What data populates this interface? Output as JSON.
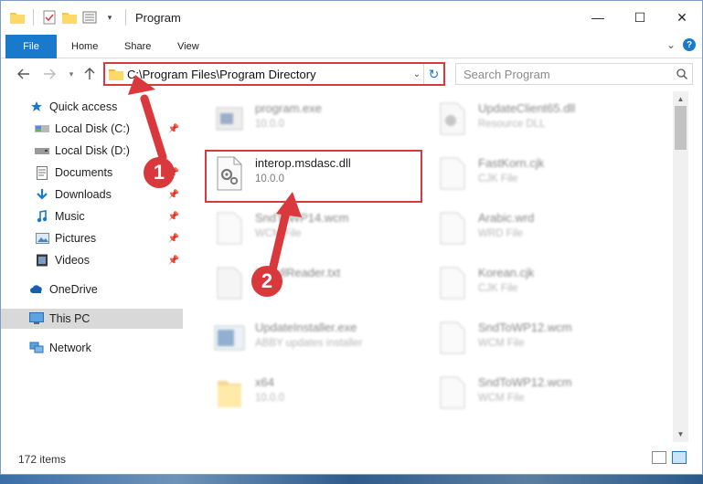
{
  "window": {
    "title": "Program",
    "minimize": "—",
    "maximize": "☐",
    "close": "✕"
  },
  "ribbon": {
    "tabs": [
      "File",
      "Home",
      "Share",
      "View"
    ],
    "help": "?",
    "expand": "⌄"
  },
  "address": {
    "path": "C:\\Program Files\\Program Directory",
    "search_placeholder": "Search Program"
  },
  "sidebar": {
    "items": [
      {
        "label": "Quick access",
        "icon": "star-icon"
      },
      {
        "label": "Local Disk (C:)",
        "icon": "drive-icon",
        "pinned": "📌"
      },
      {
        "label": "Local Disk (D:)",
        "icon": "drive-icon"
      },
      {
        "label": "Documents",
        "icon": "documents-icon",
        "pinned": "📌"
      },
      {
        "label": "Downloads",
        "icon": "download-icon",
        "pinned": "📌"
      },
      {
        "label": "Music",
        "icon": "music-icon",
        "pinned": "📌"
      },
      {
        "label": "Pictures",
        "icon": "pictures-icon",
        "pinned": "📌"
      },
      {
        "label": "Videos",
        "icon": "videos-icon",
        "pinned": "📌"
      },
      {
        "label": "OneDrive",
        "icon": "cloud-icon"
      },
      {
        "label": "This PC",
        "icon": "computer-icon"
      },
      {
        "label": "Network",
        "icon": "network-icon"
      }
    ]
  },
  "files": [
    {
      "name": "program.exe",
      "sub": "10.0.0"
    },
    {
      "name": "UpdateClient65.dll",
      "sub": "Resource DLL"
    },
    {
      "name": "interop.msdasc.dll",
      "sub": "10.0.0"
    },
    {
      "name": "FastKorn.cjk",
      "sub": "CJK File"
    },
    {
      "name": "SndToWP14.wcm",
      "sub": "WCM File"
    },
    {
      "name": "Arabic.wrd",
      "sub": "WRD File"
    },
    {
      "name": "InstallReader.txt",
      "sub": "Text"
    },
    {
      "name": "Korean.cjk",
      "sub": "CJK File"
    },
    {
      "name": "UpdateInstaller.exe",
      "sub": "ABBY updates installer"
    },
    {
      "name": "SndToWP12.wcm",
      "sub": "WCM File"
    },
    {
      "name": "x64",
      "sub": "10.0.0"
    },
    {
      "name": "SndToWP12.wcm",
      "sub": "WCM File"
    }
  ],
  "status": {
    "count": "172 items"
  },
  "annotations": {
    "step1": "1",
    "step2": "2"
  },
  "colors": {
    "accent": "#1979ca",
    "highlight": "#d9383d",
    "selection": "#d9d9d9"
  }
}
